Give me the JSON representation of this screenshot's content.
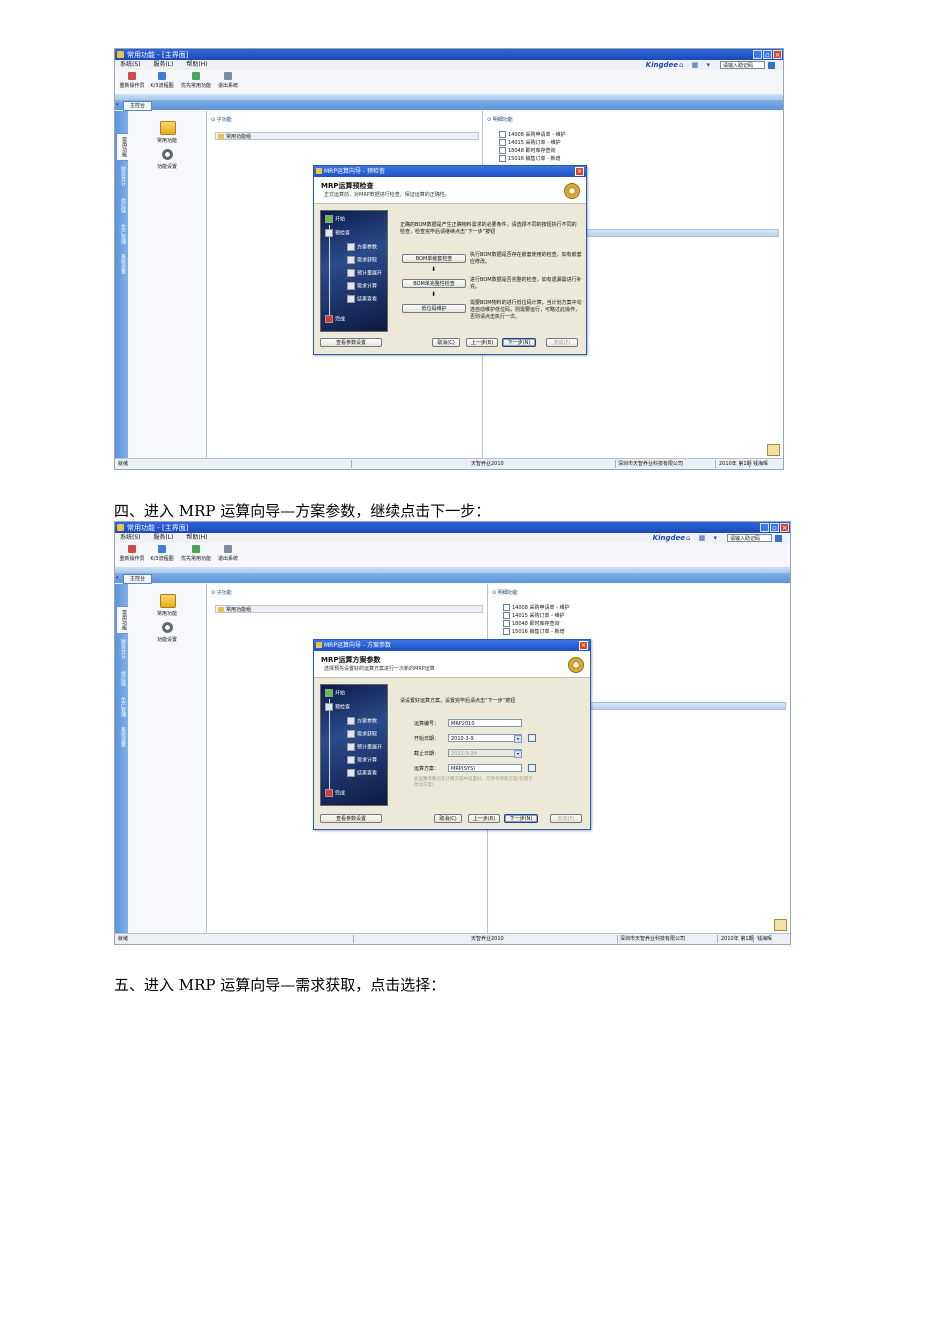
{
  "shared": {
    "app_title": "常用功能 - [主界面]",
    "menu": [
      "系统(S)",
      "服务(L)",
      "帮助(H)"
    ],
    "brand": "Kingdee",
    "help_placeholder": "请输入助记码",
    "toolbar": [
      "重新操作员",
      "K/3流程图",
      "优先常用功能",
      "退出系统"
    ],
    "tab_label": "主控台",
    "vertical_tabs": [
      "常用功能",
      "财务会计",
      "供应链",
      "生产管理",
      "系统设置"
    ],
    "left_items": [
      "常用功能",
      "功能设置"
    ],
    "sub_function_title": "子功能",
    "sub_function_item": "常用功能组",
    "detail_title": "明细功能",
    "detail_items": [
      {
        "code": "14008",
        "name": "采购申请单 - 维护"
      },
      {
        "code": "14015",
        "name": "采购订单 - 维护"
      },
      {
        "code": "18048",
        "name": "即时库存查询"
      },
      {
        "code": "15016",
        "name": "销售订单 - 新增"
      }
    ],
    "status": {
      "left": "就绪",
      "center": "天智养业2010",
      "company": "深圳市天智养业科技有限公司",
      "period": "2010年 第1期",
      "user": "钱海晖"
    },
    "flow_steps": [
      "开始",
      "预检查",
      "方案参数",
      "需求获取",
      "预计量展开",
      "需求计算",
      "结果查看",
      "完成"
    ],
    "buttons": {
      "view_params": "查看参数设置",
      "cancel": "取消(C)",
      "prev": "上一步(B)",
      "next": "下一步(N)",
      "finish": "完成(F)"
    }
  },
  "shot1": {
    "dialog_title": "MRP运算向导 - 预检查",
    "heading": "MRP运算预检查",
    "subheading": "正式运算前，对MRP数据进行检查，保证运算的正确性。",
    "intro": [
      "正确的BOM数据是产生正确物料需求的必要条件，请选择不同的按钮执行不同的检查，检查完毕后请继续点击“下一步”按钮"
    ],
    "checks": [
      {
        "button": "BOM单嵌套检查",
        "desc": [
          "执行BOM数据是否存在嵌套使用的检查，如有嵌套应修改。"
        ]
      },
      {
        "button": "BOM单完整性检查",
        "desc": [
          "进行BOM数据是否完整的检查，如有遗漏需进行补充。"
        ]
      },
      {
        "button": "低位码维护",
        "desc": [
          "需要BOM物料的进行低位码计算，当计划方案中勾选自动维护低位码，则需要运行，可略过此操作，否则请点击执行一次。"
        ]
      }
    ]
  },
  "shot2": {
    "dialog_title": "MRP运算向导 - 方案参数",
    "heading": "MRP运算方案参数",
    "subheading": "选择预先设置好的运算方案进行一次新的MRP运算",
    "instruction": "请设置好运算方案，设置完毕后请点击“下一步”按钮",
    "fields": [
      {
        "label": "运算编号：",
        "value": "MRP2010"
      },
      {
        "label": "开始日期：",
        "value": "2010-3-9"
      },
      {
        "label": "截止日期：",
        "value": "2011-3-24"
      },
      {
        "label": "运算方案：",
        "value": "MRP(SYS)"
      }
    ],
    "note": [
      "此运算参数已在计算方案中设置好，可参考修改方案(仅限于改动方案)"
    ]
  },
  "captions": {
    "step4": "四、进入 MRP 运算向导—方案参数，继续点击下一步：",
    "step5": "五、进入 MRP 运算向导—需求获取，点击选择："
  }
}
